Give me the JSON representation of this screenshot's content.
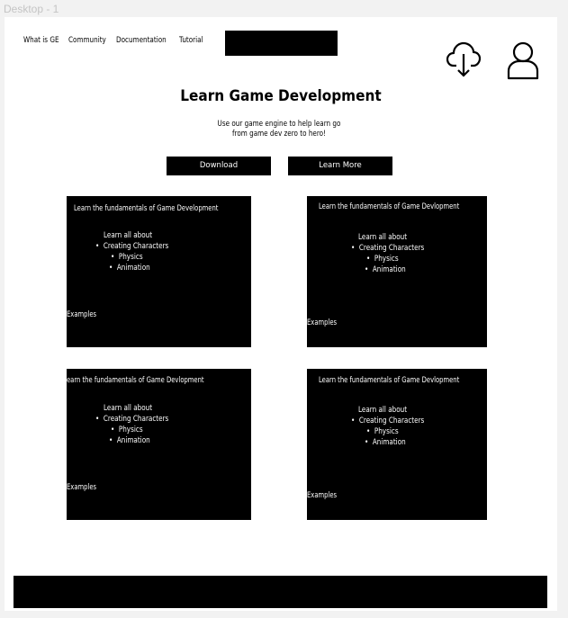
{
  "frame": {
    "label": "Desktop - 1"
  },
  "nav": {
    "links": [
      "What is GE",
      "Community",
      "Documentation",
      "Tutorial"
    ],
    "icons": {
      "download": "cloud-download-icon",
      "account": "user-icon"
    }
  },
  "hero": {
    "title": "Learn Game Development",
    "subtitle": "Use our game engine to help learn go from game dev zero to hero!",
    "download_label": "Download",
    "learn_more_label": "Learn More"
  },
  "cards": [
    {
      "title": "Learn the fundamentals of Game Development",
      "intro": "Learn all about",
      "bullets": [
        "Creating Characters",
        "Physics",
        "Animation"
      ],
      "examples": "Examples"
    },
    {
      "title": "Learn the fundamentals of Game Devlopment",
      "intro": "Learn all about",
      "bullets": [
        "Creating Characters",
        "Physics",
        "Animation"
      ],
      "examples": "Examples"
    },
    {
      "title": "earn the fundamentals of Game Devlopment",
      "intro": "Learn all about",
      "bullets": [
        "Creating Characters",
        "Physics",
        "Animation"
      ],
      "examples": "Examples"
    },
    {
      "title": "Learn the fundamentals of Game Devlopment",
      "intro": "Learn all about",
      "bullets": [
        "Creating Characters",
        "Physics",
        "Animation"
      ],
      "examples": "Examples"
    }
  ],
  "bullet_symbol": "•"
}
